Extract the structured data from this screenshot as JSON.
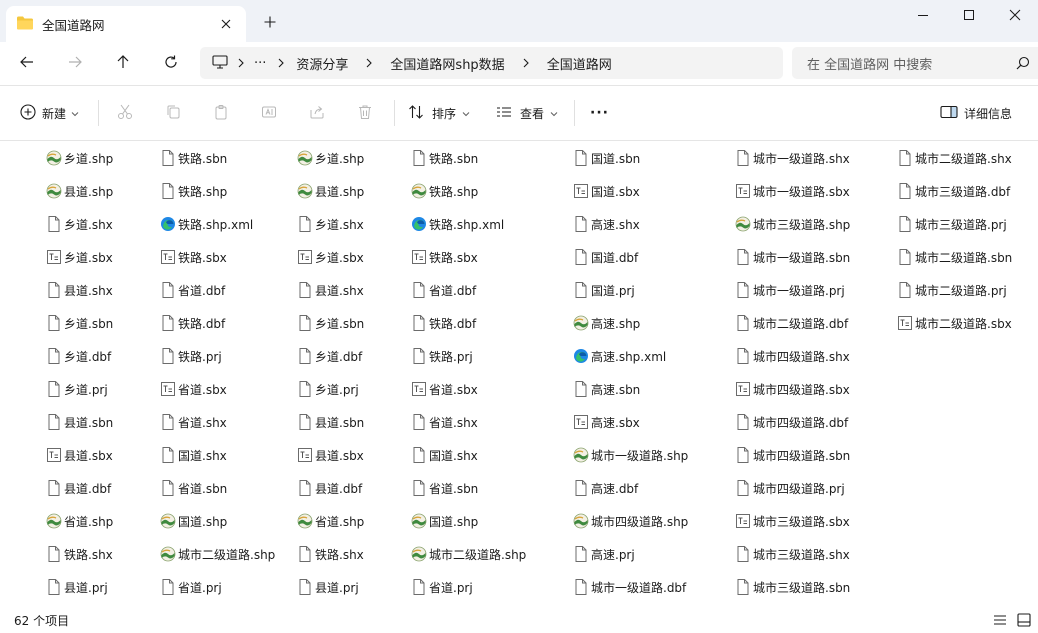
{
  "window": {
    "tab_title": "全国道路网"
  },
  "navigation": {
    "breadcrumb": [
      "资源分享",
      "全国道路网shp数据",
      "全国道路网"
    ],
    "overflow": "···",
    "search_placeholder": "在 全国道路网 中搜索"
  },
  "toolbar": {
    "new_label": "新建",
    "sort_label": "排序",
    "view_label": "查看",
    "more_label": "···",
    "details_label": "详细信息"
  },
  "files": {
    "columns": [
      [
        {
          "name": "乡道.shp",
          "type": "shp"
        },
        {
          "name": "县道.shp",
          "type": "shp"
        },
        {
          "name": "乡道.shx",
          "type": "doc"
        },
        {
          "name": "乡道.sbx",
          "type": "sbx"
        },
        {
          "name": "县道.shx",
          "type": "doc"
        },
        {
          "name": "乡道.sbn",
          "type": "doc"
        },
        {
          "name": "乡道.dbf",
          "type": "doc"
        },
        {
          "name": "乡道.prj",
          "type": "doc"
        },
        {
          "name": "县道.sbn",
          "type": "doc"
        },
        {
          "name": "县道.sbx",
          "type": "sbx"
        },
        {
          "name": "县道.dbf",
          "type": "doc"
        },
        {
          "name": "省道.shp",
          "type": "shp"
        },
        {
          "name": "铁路.shx",
          "type": "doc"
        },
        {
          "name": "县道.prj",
          "type": "doc"
        }
      ],
      [
        {
          "name": "铁路.sbn",
          "type": "doc"
        },
        {
          "name": "铁路.shp",
          "type": "doc"
        },
        {
          "name": "铁路.shp.xml",
          "type": "xml"
        },
        {
          "name": "铁路.sbx",
          "type": "sbx"
        },
        {
          "name": "省道.dbf",
          "type": "doc"
        },
        {
          "name": "铁路.dbf",
          "type": "doc"
        },
        {
          "name": "铁路.prj",
          "type": "doc"
        },
        {
          "name": "省道.sbx",
          "type": "sbx"
        },
        {
          "name": "省道.shx",
          "type": "doc"
        },
        {
          "name": "国道.shx",
          "type": "doc"
        },
        {
          "name": "省道.sbn",
          "type": "doc"
        },
        {
          "name": "国道.shp",
          "type": "shp"
        },
        {
          "name": "城市二级道路.shp",
          "type": "shp"
        },
        {
          "name": "省道.prj",
          "type": "doc"
        }
      ],
      [
        {
          "name": "乡道.shp",
          "type": "shp"
        },
        {
          "name": "县道.shp",
          "type": "shp"
        },
        {
          "name": "乡道.shx",
          "type": "doc"
        },
        {
          "name": "乡道.sbx",
          "type": "sbx"
        },
        {
          "name": "县道.shx",
          "type": "doc"
        },
        {
          "name": "乡道.sbn",
          "type": "doc"
        },
        {
          "name": "乡道.dbf",
          "type": "doc"
        },
        {
          "name": "乡道.prj",
          "type": "doc"
        },
        {
          "name": "县道.sbn",
          "type": "doc"
        },
        {
          "name": "县道.sbx",
          "type": "sbx"
        },
        {
          "name": "县道.dbf",
          "type": "doc"
        },
        {
          "name": "省道.shp",
          "type": "shp"
        },
        {
          "name": "铁路.shx",
          "type": "doc"
        },
        {
          "name": "县道.prj",
          "type": "doc"
        }
      ],
      [
        {
          "name": "铁路.sbn",
          "type": "doc"
        },
        {
          "name": "铁路.shp",
          "type": "shp"
        },
        {
          "name": "铁路.shp.xml",
          "type": "xml"
        },
        {
          "name": "铁路.sbx",
          "type": "sbx"
        },
        {
          "name": "省道.dbf",
          "type": "doc"
        },
        {
          "name": "铁路.dbf",
          "type": "doc"
        },
        {
          "name": "铁路.prj",
          "type": "doc"
        },
        {
          "name": "省道.sbx",
          "type": "sbx"
        },
        {
          "name": "省道.shx",
          "type": "doc"
        },
        {
          "name": "国道.shx",
          "type": "doc"
        },
        {
          "name": "省道.sbn",
          "type": "doc"
        },
        {
          "name": "国道.shp",
          "type": "shp"
        },
        {
          "name": "城市二级道路.shp",
          "type": "shp"
        },
        {
          "name": "省道.prj",
          "type": "doc"
        }
      ],
      [
        {
          "name": "国道.sbn",
          "type": "doc"
        },
        {
          "name": "国道.sbx",
          "type": "sbx"
        },
        {
          "name": "高速.shx",
          "type": "doc"
        },
        {
          "name": "国道.dbf",
          "type": "doc"
        },
        {
          "name": "国道.prj",
          "type": "doc"
        },
        {
          "name": "高速.shp",
          "type": "shp"
        },
        {
          "name": "高速.shp.xml",
          "type": "xml"
        },
        {
          "name": "高速.sbn",
          "type": "doc"
        },
        {
          "name": "高速.sbx",
          "type": "sbx"
        },
        {
          "name": "城市一级道路.shp",
          "type": "shp"
        },
        {
          "name": "高速.dbf",
          "type": "doc"
        },
        {
          "name": "城市四级道路.shp",
          "type": "shp"
        },
        {
          "name": "高速.prj",
          "type": "doc"
        },
        {
          "name": "城市一级道路.dbf",
          "type": "doc"
        }
      ],
      [
        {
          "name": "城市一级道路.shx",
          "type": "doc"
        },
        {
          "name": "城市一级道路.sbx",
          "type": "sbx"
        },
        {
          "name": "城市三级道路.shp",
          "type": "shp"
        },
        {
          "name": "城市一级道路.sbn",
          "type": "doc"
        },
        {
          "name": "城市一级道路.prj",
          "type": "doc"
        },
        {
          "name": "城市二级道路.dbf",
          "type": "doc"
        },
        {
          "name": "城市四级道路.shx",
          "type": "doc"
        },
        {
          "name": "城市四级道路.sbx",
          "type": "sbx"
        },
        {
          "name": "城市四级道路.dbf",
          "type": "doc"
        },
        {
          "name": "城市四级道路.sbn",
          "type": "doc"
        },
        {
          "name": "城市四级道路.prj",
          "type": "doc"
        },
        {
          "name": "城市三级道路.sbx",
          "type": "sbx"
        },
        {
          "name": "城市三级道路.shx",
          "type": "doc"
        },
        {
          "name": "城市三级道路.sbn",
          "type": "doc"
        }
      ],
      [
        {
          "name": "城市二级道路.shx",
          "type": "doc"
        },
        {
          "name": "城市三级道路.dbf",
          "type": "doc"
        },
        {
          "name": "城市三级道路.prj",
          "type": "doc"
        },
        {
          "name": "城市二级道路.sbn",
          "type": "doc"
        },
        {
          "name": "城市二级道路.prj",
          "type": "doc"
        },
        {
          "name": "城市二级道路.sbx",
          "type": "sbx"
        }
      ]
    ]
  },
  "status": {
    "item_count": "62 个项目"
  },
  "colors": {
    "titlebar_bg": "#eff2f7",
    "folder": "#f4c73e",
    "accent": "#0067c0",
    "edge_blue": "#1e88e5",
    "edge_green": "#35c16b"
  }
}
